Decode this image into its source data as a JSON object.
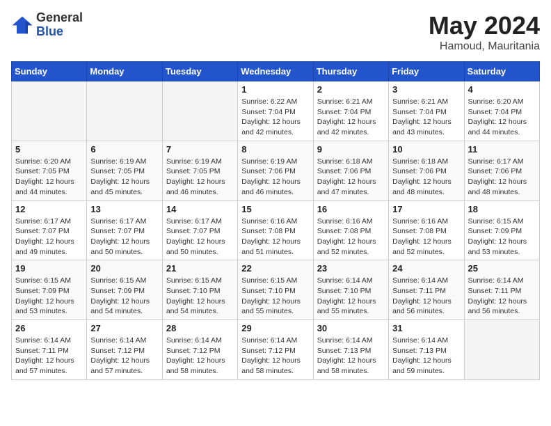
{
  "header": {
    "logo_general": "General",
    "logo_blue": "Blue",
    "title": "May 2024",
    "location": "Hamoud, Mauritania"
  },
  "days_of_week": [
    "Sunday",
    "Monday",
    "Tuesday",
    "Wednesday",
    "Thursday",
    "Friday",
    "Saturday"
  ],
  "weeks": [
    [
      {
        "day": "",
        "info": ""
      },
      {
        "day": "",
        "info": ""
      },
      {
        "day": "",
        "info": ""
      },
      {
        "day": "1",
        "info": "Sunrise: 6:22 AM\nSunset: 7:04 PM\nDaylight: 12 hours\nand 42 minutes."
      },
      {
        "day": "2",
        "info": "Sunrise: 6:21 AM\nSunset: 7:04 PM\nDaylight: 12 hours\nand 42 minutes."
      },
      {
        "day": "3",
        "info": "Sunrise: 6:21 AM\nSunset: 7:04 PM\nDaylight: 12 hours\nand 43 minutes."
      },
      {
        "day": "4",
        "info": "Sunrise: 6:20 AM\nSunset: 7:04 PM\nDaylight: 12 hours\nand 44 minutes."
      }
    ],
    [
      {
        "day": "5",
        "info": "Sunrise: 6:20 AM\nSunset: 7:05 PM\nDaylight: 12 hours\nand 44 minutes."
      },
      {
        "day": "6",
        "info": "Sunrise: 6:19 AM\nSunset: 7:05 PM\nDaylight: 12 hours\nand 45 minutes."
      },
      {
        "day": "7",
        "info": "Sunrise: 6:19 AM\nSunset: 7:05 PM\nDaylight: 12 hours\nand 46 minutes."
      },
      {
        "day": "8",
        "info": "Sunrise: 6:19 AM\nSunset: 7:06 PM\nDaylight: 12 hours\nand 46 minutes."
      },
      {
        "day": "9",
        "info": "Sunrise: 6:18 AM\nSunset: 7:06 PM\nDaylight: 12 hours\nand 47 minutes."
      },
      {
        "day": "10",
        "info": "Sunrise: 6:18 AM\nSunset: 7:06 PM\nDaylight: 12 hours\nand 48 minutes."
      },
      {
        "day": "11",
        "info": "Sunrise: 6:17 AM\nSunset: 7:06 PM\nDaylight: 12 hours\nand 48 minutes."
      }
    ],
    [
      {
        "day": "12",
        "info": "Sunrise: 6:17 AM\nSunset: 7:07 PM\nDaylight: 12 hours\nand 49 minutes."
      },
      {
        "day": "13",
        "info": "Sunrise: 6:17 AM\nSunset: 7:07 PM\nDaylight: 12 hours\nand 50 minutes."
      },
      {
        "day": "14",
        "info": "Sunrise: 6:17 AM\nSunset: 7:07 PM\nDaylight: 12 hours\nand 50 minutes."
      },
      {
        "day": "15",
        "info": "Sunrise: 6:16 AM\nSunset: 7:08 PM\nDaylight: 12 hours\nand 51 minutes."
      },
      {
        "day": "16",
        "info": "Sunrise: 6:16 AM\nSunset: 7:08 PM\nDaylight: 12 hours\nand 52 minutes."
      },
      {
        "day": "17",
        "info": "Sunrise: 6:16 AM\nSunset: 7:08 PM\nDaylight: 12 hours\nand 52 minutes."
      },
      {
        "day": "18",
        "info": "Sunrise: 6:15 AM\nSunset: 7:09 PM\nDaylight: 12 hours\nand 53 minutes."
      }
    ],
    [
      {
        "day": "19",
        "info": "Sunrise: 6:15 AM\nSunset: 7:09 PM\nDaylight: 12 hours\nand 53 minutes."
      },
      {
        "day": "20",
        "info": "Sunrise: 6:15 AM\nSunset: 7:09 PM\nDaylight: 12 hours\nand 54 minutes."
      },
      {
        "day": "21",
        "info": "Sunrise: 6:15 AM\nSunset: 7:10 PM\nDaylight: 12 hours\nand 54 minutes."
      },
      {
        "day": "22",
        "info": "Sunrise: 6:15 AM\nSunset: 7:10 PM\nDaylight: 12 hours\nand 55 minutes."
      },
      {
        "day": "23",
        "info": "Sunrise: 6:14 AM\nSunset: 7:10 PM\nDaylight: 12 hours\nand 55 minutes."
      },
      {
        "day": "24",
        "info": "Sunrise: 6:14 AM\nSunset: 7:11 PM\nDaylight: 12 hours\nand 56 minutes."
      },
      {
        "day": "25",
        "info": "Sunrise: 6:14 AM\nSunset: 7:11 PM\nDaylight: 12 hours\nand 56 minutes."
      }
    ],
    [
      {
        "day": "26",
        "info": "Sunrise: 6:14 AM\nSunset: 7:11 PM\nDaylight: 12 hours\nand 57 minutes."
      },
      {
        "day": "27",
        "info": "Sunrise: 6:14 AM\nSunset: 7:12 PM\nDaylight: 12 hours\nand 57 minutes."
      },
      {
        "day": "28",
        "info": "Sunrise: 6:14 AM\nSunset: 7:12 PM\nDaylight: 12 hours\nand 58 minutes."
      },
      {
        "day": "29",
        "info": "Sunrise: 6:14 AM\nSunset: 7:12 PM\nDaylight: 12 hours\nand 58 minutes."
      },
      {
        "day": "30",
        "info": "Sunrise: 6:14 AM\nSunset: 7:13 PM\nDaylight: 12 hours\nand 58 minutes."
      },
      {
        "day": "31",
        "info": "Sunrise: 6:14 AM\nSunset: 7:13 PM\nDaylight: 12 hours\nand 59 minutes."
      },
      {
        "day": "",
        "info": ""
      }
    ]
  ]
}
